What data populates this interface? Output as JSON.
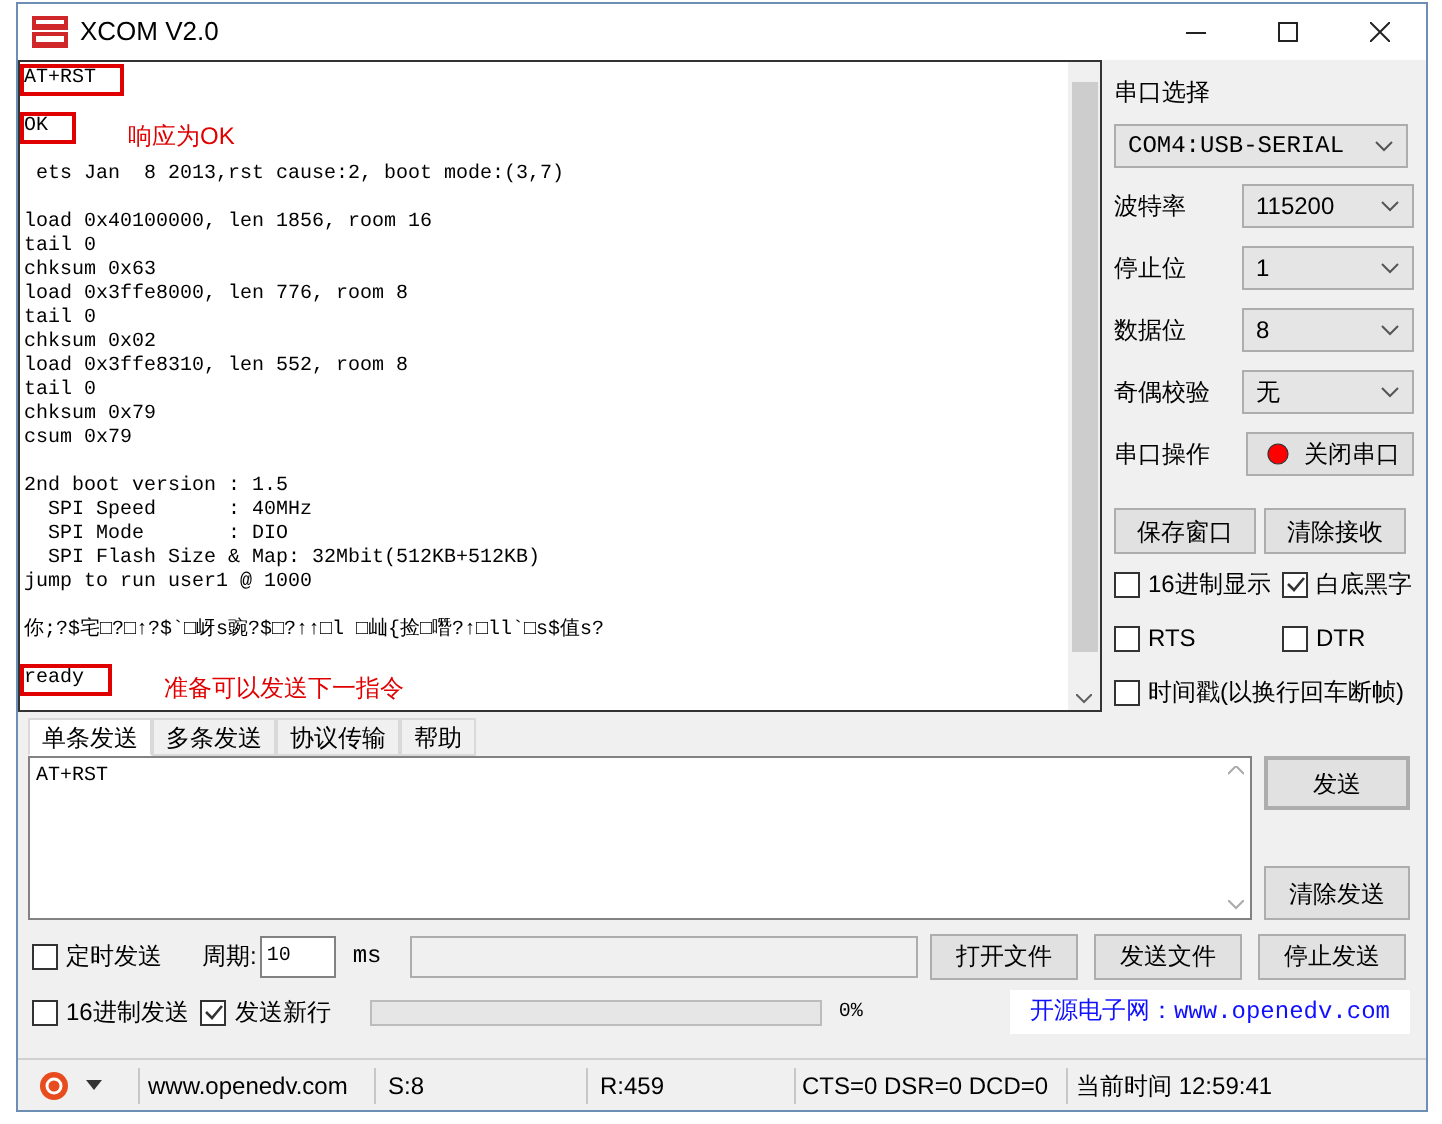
{
  "window": {
    "title": "XCOM V2.0"
  },
  "receive": {
    "blocks": [
      [
        {
          "text": "AT+RST",
          "boxed": true
        }
      ],
      [
        {
          "text": "OK",
          "boxed": true,
          "note": "响应为OK"
        }
      ],
      [
        {
          "text": " ets Jan  8 2013,rst cause:2, boot mode:(3,7)",
          "boxed": false
        }
      ],
      [
        {
          "text": "load 0x40100000, len 1856, room 16",
          "boxed": false
        },
        {
          "text": "tail 0",
          "boxed": false
        },
        {
          "text": "chksum 0x63",
          "boxed": false
        },
        {
          "text": "load 0x3ffe8000, len 776, room 8",
          "boxed": false
        },
        {
          "text": "tail 0",
          "boxed": false
        },
        {
          "text": "chksum 0x02",
          "boxed": false
        },
        {
          "text": "load 0x3ffe8310, len 552, room 8",
          "boxed": false
        },
        {
          "text": "tail 0",
          "boxed": false
        },
        {
          "text": "chksum 0x79",
          "boxed": false
        },
        {
          "text": "csum 0x79",
          "boxed": false
        }
      ],
      [
        {
          "text": "2nd boot version : 1.5",
          "boxed": false
        },
        {
          "text": "  SPI Speed      : 40MHz",
          "boxed": false
        },
        {
          "text": "  SPI Mode       : DIO",
          "boxed": false
        },
        {
          "text": "  SPI Flash Size & Map: 32Mbit(512KB+512KB)",
          "boxed": false
        },
        {
          "text": "jump to run user1 @ 1000",
          "boxed": false
        }
      ],
      [
        {
          "text": "你;?$宅□?□↑?$`□岈s豌?$□?↑↑□l □屾{捡□噆?↑□ll`□s$值s?",
          "boxed": false
        }
      ],
      [
        {
          "text": "ready",
          "boxed": true,
          "note": "准备可以发送下一指令"
        }
      ]
    ]
  },
  "settings": {
    "port_label": "串口选择",
    "port": "COM4:USB-SERIAL",
    "rows": [
      {
        "label": "波特率",
        "value": "115200"
      },
      {
        "label": "停止位",
        "value": "1"
      },
      {
        "label": "数据位",
        "value": "8"
      },
      {
        "label": "奇偶校验",
        "value": "无"
      }
    ],
    "operation_label": "串口操作",
    "operation_button": "关闭串口",
    "port_open": true,
    "buttons": [
      "保存窗口",
      "清除接收"
    ],
    "checks": [
      {
        "label": "16进制显示",
        "checked": false
      },
      {
        "label": "白底黑字",
        "checked": true
      },
      {
        "label": "RTS",
        "checked": false
      },
      {
        "label": "DTR",
        "checked": false
      },
      {
        "label": "时间戳(以换行回车断帧)",
        "checked": false
      }
    ]
  },
  "tabs": [
    {
      "label": "单条发送",
      "selected": true
    },
    {
      "label": "多条发送",
      "selected": false
    },
    {
      "label": "协议传输",
      "selected": false
    },
    {
      "label": "帮助",
      "selected": false
    }
  ],
  "send": {
    "value": "AT+RST",
    "send_button": "发送",
    "clear_button": "清除发送",
    "timed": {
      "label": "定时发送",
      "checked": false
    },
    "period_label": "周期:",
    "period": "10",
    "unit": "ms",
    "hex": {
      "label": "16进制发送",
      "checked": false
    },
    "newline": {
      "label": "发送新行",
      "checked": true
    },
    "file_buttons": [
      "打开文件",
      "发送文件",
      "停止发送"
    ],
    "progress": {
      "level": 0,
      "reading": "0%"
    },
    "banner": "开源电子网：www.openedv.com"
  },
  "status_bar": {
    "site": "www.openedv.com",
    "sent": "S:8",
    "received": "R:459",
    "lines": "CTS=0 DSR=0 DCD=0",
    "time": "当前时间 12:59:41"
  }
}
